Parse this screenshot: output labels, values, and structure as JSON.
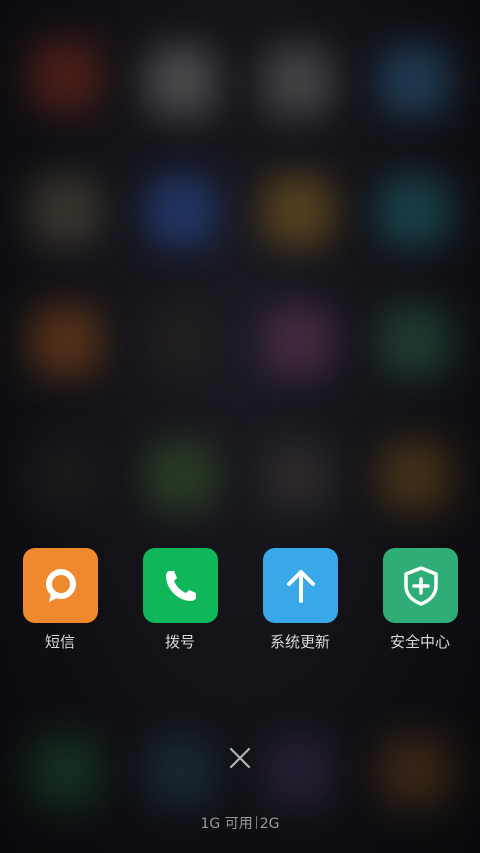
{
  "recent_apps": [
    {
      "name": "短信",
      "icon": "message-bubble-icon",
      "color": "#F0892E"
    },
    {
      "name": "拨号",
      "icon": "phone-handset-icon",
      "color": "#0FB75A"
    },
    {
      "name": "系统更新",
      "icon": "arrow-up-icon",
      "color": "#39A8E8"
    },
    {
      "name": "安全中心",
      "icon": "shield-plus-icon",
      "color": "#2EAE76"
    }
  ],
  "memory": {
    "available": "1G 可用",
    "total": "2G"
  },
  "close_icon": "close-icon",
  "colors": {
    "background": "#101014",
    "label": "#D9D9D9",
    "memory_text": "#9A9A9A"
  }
}
